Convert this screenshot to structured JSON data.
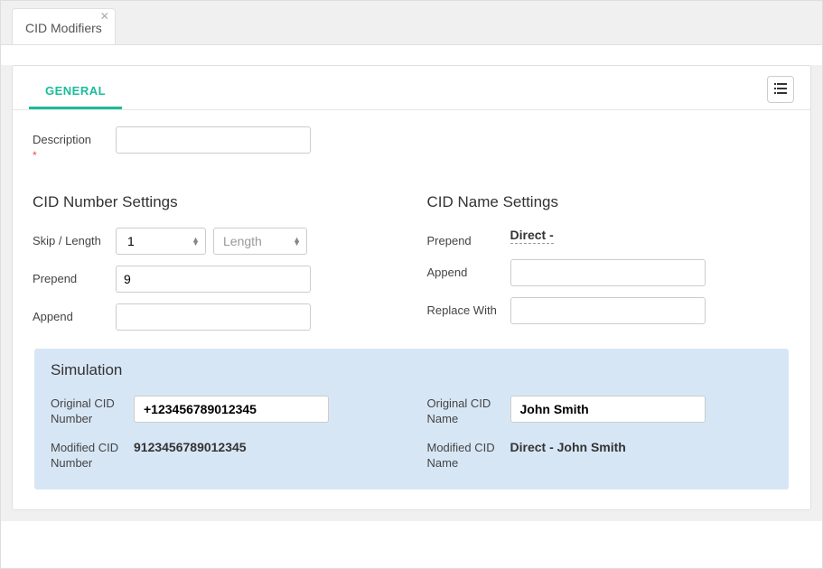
{
  "tab": {
    "title": "CID Modifiers",
    "close": "✕"
  },
  "subtab": {
    "general": "GENERAL"
  },
  "labels": {
    "description": "Description",
    "required_mark": "*",
    "cid_number_settings": "CID Number Settings",
    "cid_name_settings": "CID Name Settings",
    "skip_length": "Skip / Length",
    "prepend": "Prepend",
    "append": "Append",
    "replace_with": "Replace With",
    "length_placeholder": "Length",
    "simulation": "Simulation",
    "original_cid_number": "Original CID Number",
    "modified_cid_number": "Modified CID Number",
    "original_cid_name": "Original CID Name",
    "modified_cid_name": "Modified CID Name"
  },
  "values": {
    "description": "",
    "skip": "1",
    "length": "",
    "num_prepend": "9",
    "num_append": "",
    "name_prepend": "Direct -",
    "name_append": "",
    "name_replace": "",
    "orig_num": "+123456789012345",
    "mod_num": "9123456789012345",
    "orig_name": "John Smith",
    "mod_name": "Direct - John Smith"
  }
}
